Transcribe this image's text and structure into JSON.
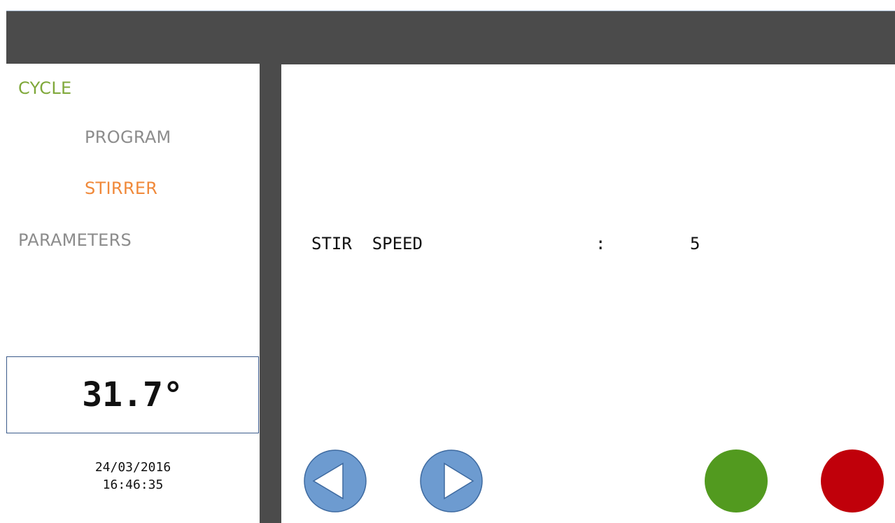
{
  "menu": {
    "cycle": "CYCLE",
    "program": "PROGRAM",
    "stirrer": "STIRRER",
    "parameters": "PARAMETERS"
  },
  "status": {
    "temperature": "31.7°",
    "date": "24/03/2016",
    "time": "16:46:35"
  },
  "param": {
    "label": "STIR  SPEED",
    "separator": ":",
    "value": "5"
  },
  "colors": {
    "header": "#4b4b4b",
    "cycle": "#7fa83a",
    "menu_inactive": "#8c8c8c",
    "menu_active": "#f0893a",
    "nav_button": "#6d9bd0",
    "confirm_button": "#529a1f",
    "cancel_button": "#c0000a"
  },
  "icons": {
    "prev": "triangle-left-icon",
    "next": "triangle-right-icon",
    "confirm": "green-circle-icon",
    "cancel": "red-circle-icon"
  }
}
